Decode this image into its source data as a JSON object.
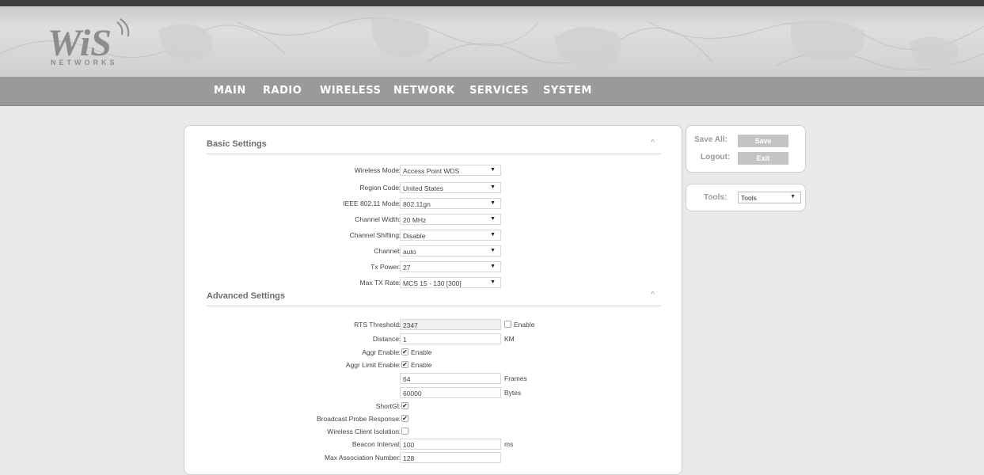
{
  "brand": {
    "logo_text": "WiS",
    "tagline": "NETWORKS"
  },
  "nav": [
    "MAIN",
    "RADIO",
    "WIRELESS",
    "NETWORK",
    "SERVICES",
    "SYSTEM"
  ],
  "basic": {
    "title": "Basic Settings",
    "fields": [
      {
        "label": "Wireless Mode",
        "value": "Access Point WDS"
      },
      {
        "label": "Region Code",
        "value": "United States"
      },
      {
        "label": "IEEE 802.11 Mode",
        "value": "802.11gn"
      },
      {
        "label": "Channel Width",
        "value": "20 MHz"
      },
      {
        "label": "Channel Shifting",
        "value": "Disable"
      },
      {
        "label": "Channel",
        "value": "auto"
      },
      {
        "label": "Tx Power",
        "value": "27"
      },
      {
        "label": "Max TX Rate",
        "value": "MCS 15 - 130 [300]"
      }
    ]
  },
  "advanced": {
    "title": "Advanced Settings",
    "rts": {
      "label": "RTS Threshold",
      "value": "2347",
      "enable_label": "Enable",
      "enabled": false
    },
    "distance": {
      "label": "Distance",
      "value": "1",
      "unit": "KM"
    },
    "aggr_enable": {
      "label": "Aggr Enable",
      "checkbox_label": "Enable",
      "checked": true
    },
    "aggr_limit_enable": {
      "label": "Aggr Limit Enable",
      "checkbox_label": "Enable",
      "checked": true
    },
    "frames": {
      "value": "64",
      "unit": "Frames"
    },
    "bytes": {
      "value": "60000",
      "unit": "Bytes"
    },
    "short_gi": {
      "label": "ShortGI",
      "checked": true
    },
    "broadcast_probe": {
      "label": "Broadcast Probe Response",
      "checked": true
    },
    "client_isolation": {
      "label": "Wireless Client Isolation",
      "checked": false
    },
    "beacon": {
      "label": "Beacon Interval",
      "value": "100",
      "unit": "ms"
    },
    "max_assoc": {
      "label": "Max Association Number",
      "value": "128"
    }
  },
  "side": {
    "save_all_label": "Save All:",
    "save_button": "Save",
    "logout_label": "Logout:",
    "exit_button": "Exit",
    "tools_label": "Tools:",
    "tools_value": "Tools"
  },
  "colors": {
    "nav_bg": "#9a9a9a",
    "header_top": "#3d3d3d",
    "button_bg": "#c4c4c4"
  }
}
